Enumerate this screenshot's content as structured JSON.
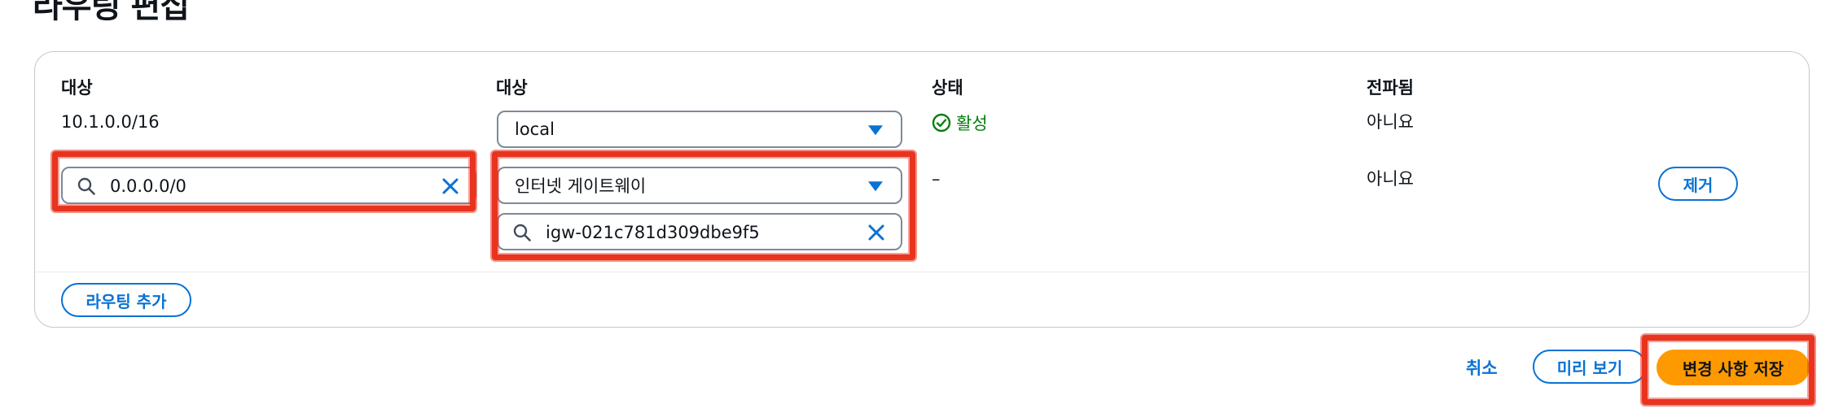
{
  "page": {
    "title": "라우팅 편집"
  },
  "table": {
    "headers": {
      "destination": "대상",
      "target": "대상",
      "status": "상태",
      "propagated": "전파됨"
    },
    "rows": [
      {
        "destination": "10.1.0.0/16",
        "target_select": "local",
        "status": "활성",
        "propagated": "아니요"
      },
      {
        "destination_value": "0.0.0.0/0",
        "target_select": "인터넷 게이트웨이",
        "target_search_value": "igw-021c781d309dbe9f5",
        "status": "–",
        "propagated": "아니요",
        "remove_label": "제거"
      }
    ]
  },
  "add_route_label": "라우팅 추가",
  "footer": {
    "cancel_label": "취소",
    "preview_label": "미리 보기",
    "save_label": "변경 사항 저장"
  },
  "colors": {
    "accent": "#0972d3",
    "primary_button": "#ff9900",
    "success": "#037f0c",
    "highlight": "#e8331f"
  },
  "icons": {
    "search": "search-icon",
    "clear": "close-icon",
    "status": "check-circle-icon",
    "caret": "caret-down-icon"
  }
}
